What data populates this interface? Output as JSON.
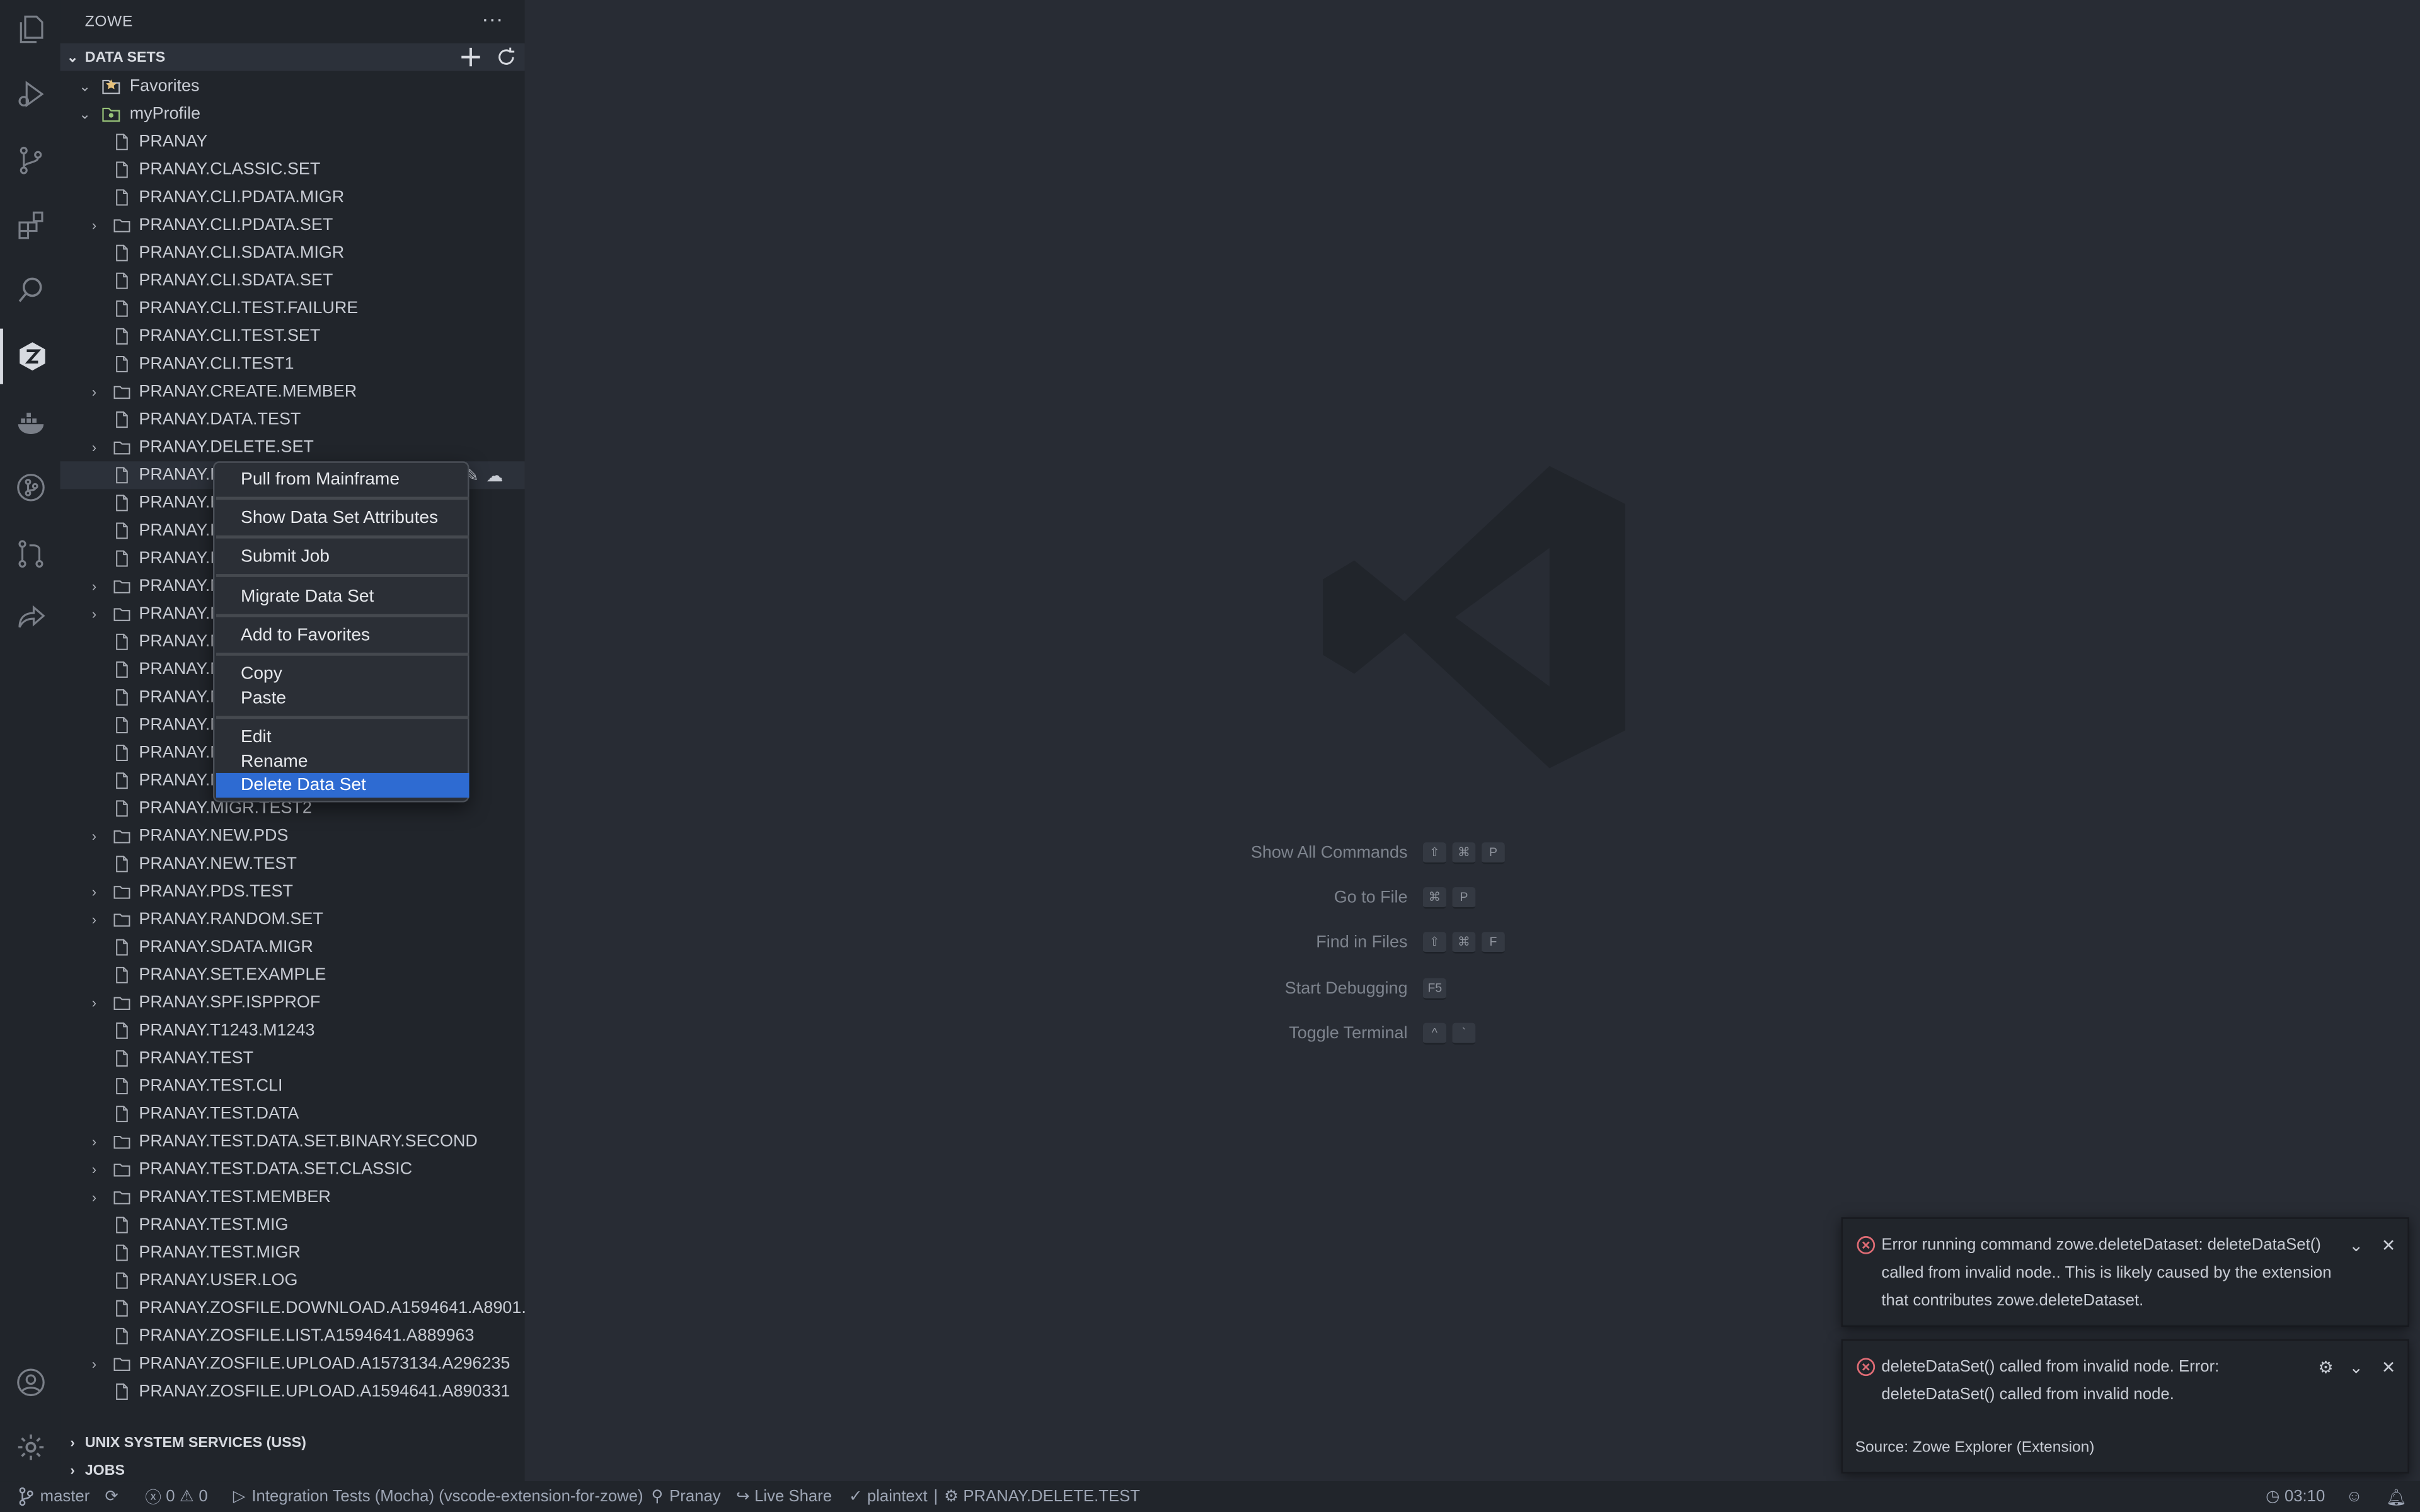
{
  "sidebar": {
    "title": "ZOWE",
    "more": "···",
    "data_sets_header": "DATA SETS",
    "uss_header": "UNIX SYSTEM SERVICES (USS)",
    "jobs_header": "JOBS",
    "favorites": "Favorites",
    "profile": "myProfile",
    "items": [
      {
        "label": "PRANAY",
        "type": "file"
      },
      {
        "label": "PRANAY.CLASSIC.SET",
        "type": "file"
      },
      {
        "label": "PRANAY.CLI.PDATA.MIGR",
        "type": "file"
      },
      {
        "label": "PRANAY.CLI.PDATA.SET",
        "type": "folder"
      },
      {
        "label": "PRANAY.CLI.SDATA.MIGR",
        "type": "file"
      },
      {
        "label": "PRANAY.CLI.SDATA.SET",
        "type": "file"
      },
      {
        "label": "PRANAY.CLI.TEST.FAILURE",
        "type": "file"
      },
      {
        "label": "PRANAY.CLI.TEST.SET",
        "type": "file"
      },
      {
        "label": "PRANAY.CLI.TEST1",
        "type": "file"
      },
      {
        "label": "PRANAY.CREATE.MEMBER",
        "type": "folder"
      },
      {
        "label": "PRANAY.DATA.TEST",
        "type": "file"
      },
      {
        "label": "PRANAY.DELETE.SET",
        "type": "folder"
      },
      {
        "label": "PRANAY.D",
        "type": "file"
      },
      {
        "label": "PRANAY.E",
        "type": "file"
      },
      {
        "label": "PRANAY.H",
        "type": "file"
      },
      {
        "label": "PRANAY.IS",
        "type": "file"
      },
      {
        "label": "PRANAY.M",
        "type": "folder"
      },
      {
        "label": "PRANAY.M",
        "type": "folder"
      },
      {
        "label": "PRANAY.M",
        "type": "file"
      },
      {
        "label": "PRANAY.M",
        "type": "file"
      },
      {
        "label": "PRANAY.M",
        "type": "file"
      },
      {
        "label": "PRANAY.M",
        "type": "file"
      },
      {
        "label": "PRANAY.M",
        "type": "file"
      },
      {
        "label": "PRANAY.M",
        "type": "file"
      },
      {
        "label": "PRANAY.MIGR.TEST2",
        "type": "file"
      },
      {
        "label": "PRANAY.NEW.PDS",
        "type": "folder"
      },
      {
        "label": "PRANAY.NEW.TEST",
        "type": "file"
      },
      {
        "label": "PRANAY.PDS.TEST",
        "type": "folder"
      },
      {
        "label": "PRANAY.RANDOM.SET",
        "type": "folder"
      },
      {
        "label": "PRANAY.SDATA.MIGR",
        "type": "file"
      },
      {
        "label": "PRANAY.SET.EXAMPLE",
        "type": "file"
      },
      {
        "label": "PRANAY.SPF.ISPPROF",
        "type": "folder"
      },
      {
        "label": "PRANAY.T1243.M1243",
        "type": "file"
      },
      {
        "label": "PRANAY.TEST",
        "type": "file"
      },
      {
        "label": "PRANAY.TEST.CLI",
        "type": "file"
      },
      {
        "label": "PRANAY.TEST.DATA",
        "type": "file"
      },
      {
        "label": "PRANAY.TEST.DATA.SET.BINARY.SECOND",
        "type": "folder"
      },
      {
        "label": "PRANAY.TEST.DATA.SET.CLASSIC",
        "type": "folder"
      },
      {
        "label": "PRANAY.TEST.MEMBER",
        "type": "folder"
      },
      {
        "label": "PRANAY.TEST.MIG",
        "type": "file"
      },
      {
        "label": "PRANAY.TEST.MIGR",
        "type": "file"
      },
      {
        "label": "PRANAY.USER.LOG",
        "type": "file"
      },
      {
        "label": "PRANAY.ZOSFILE.DOWNLOAD.A1594641.A8901...",
        "type": "file"
      },
      {
        "label": "PRANAY.ZOSFILE.LIST.A1594641.A889963",
        "type": "file"
      },
      {
        "label": "PRANAY.ZOSFILE.UPLOAD.A1573134.A296235",
        "type": "folder"
      },
      {
        "label": "PRANAY.ZOSFILE.UPLOAD.A1594641.A890331",
        "type": "file"
      }
    ]
  },
  "context_menu": {
    "pull": "Pull from Mainframe",
    "show_attrs": "Show Data Set Attributes",
    "submit": "Submit Job",
    "migrate": "Migrate Data Set",
    "add_fav": "Add to Favorites",
    "copy": "Copy",
    "paste": "Paste",
    "edit": "Edit",
    "rename": "Rename",
    "delete": "Delete Data Set"
  },
  "shortcuts": [
    {
      "name": "Show All Commands",
      "keys": [
        "⇧",
        "⌘",
        "P"
      ]
    },
    {
      "name": "Go to File",
      "keys": [
        "⌘",
        "P"
      ]
    },
    {
      "name": "Find in Files",
      "keys": [
        "⇧",
        "⌘",
        "F"
      ]
    },
    {
      "name": "Start Debugging",
      "keys": [
        "F5"
      ]
    },
    {
      "name": "Toggle Terminal",
      "keys": [
        "^",
        "`"
      ]
    }
  ],
  "notifications": {
    "first_line1": "Error running command zowe.deleteDataset: deleteDataSet()",
    "first_line2": "called from invalid node.. This is likely caused by the extension",
    "first_line3": "that contributes zowe.deleteDataset.",
    "second_line1": "deleteDataSet() called from invalid node. Error:",
    "second_line2": "deleteDataSet() called from invalid node.",
    "second_source": "Source: Zowe Explorer (Extension)"
  },
  "status_bar": {
    "branch": "master",
    "errors": "0",
    "warnings": "0",
    "run_config": "Integration Tests (Mocha) (vscode-extension-for-zowe)",
    "user": "Pranay",
    "live_share": "Live Share",
    "language": "plaintext",
    "dataset": "PRANAY.DELETE.TEST",
    "time": "03:10"
  },
  "colors": {
    "accent": "#2e6bd2",
    "error": "#e06c75"
  }
}
